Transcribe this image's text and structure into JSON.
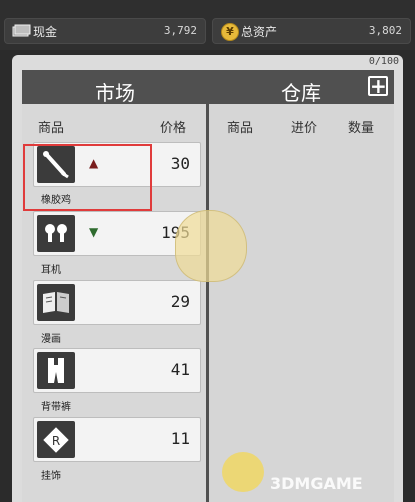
{
  "topbar": {
    "cash_label": "现金",
    "cash_value": "3,792",
    "assets_label": "总资产",
    "assets_value": "3,802",
    "assets_icon_text": "¥"
  },
  "panel": {
    "capacity": "0/100",
    "market_title": "市场",
    "warehouse_title": "仓库",
    "add_button": "+"
  },
  "market_columns": {
    "item": "商品",
    "price": "价格"
  },
  "warehouse_columns": {
    "item": "商品",
    "buy_price": "进价",
    "quantity": "数量"
  },
  "market_items": [
    {
      "name": "橡胶鸡",
      "price": "30",
      "trend": "up",
      "icon": "rubber-chicken-icon"
    },
    {
      "name": "耳机",
      "price": "195",
      "trend": "down",
      "icon": "earphones-icon"
    },
    {
      "name": "漫画",
      "price": "29",
      "trend": "none",
      "icon": "comic-book-icon"
    },
    {
      "name": "背带裤",
      "price": "41",
      "trend": "none",
      "icon": "overalls-icon"
    },
    {
      "name": "挂饰",
      "price": "11",
      "trend": "none",
      "icon": "pendant-icon"
    }
  ],
  "colors": {
    "up_arrow": "#7a1d1d",
    "down_arrow": "#2e6b2e",
    "highlight": "#e03b3b"
  },
  "watermark": "3DMGAME"
}
